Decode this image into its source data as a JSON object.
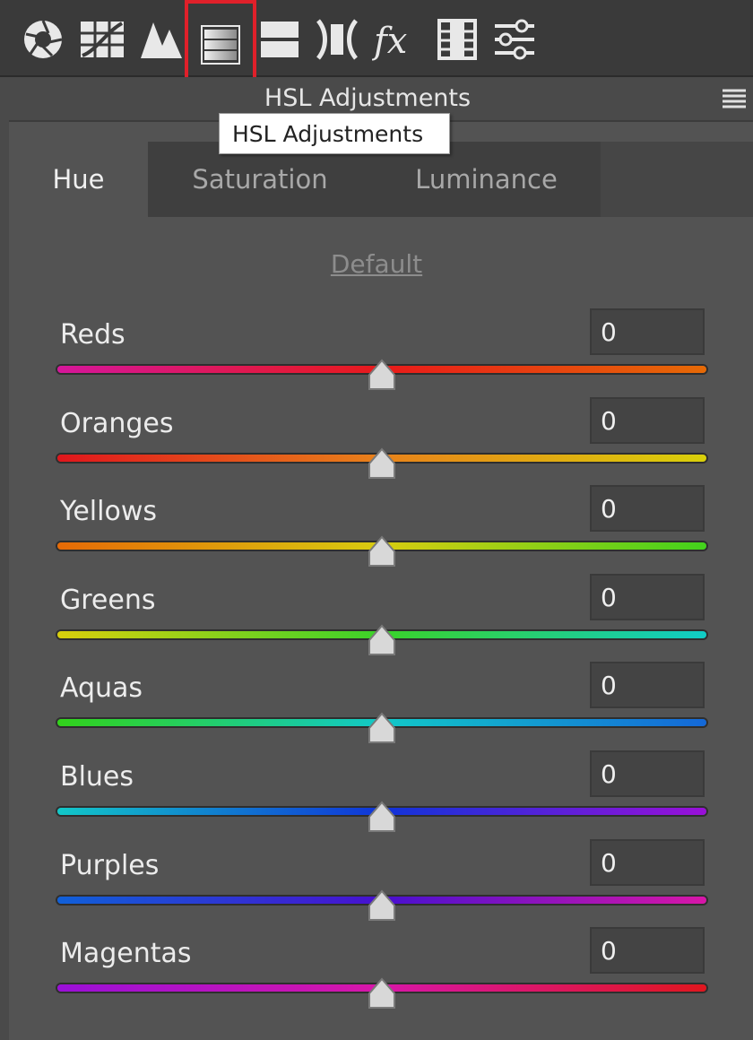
{
  "toolbar": {
    "icons": [
      {
        "name": "basic-aperture-icon"
      },
      {
        "name": "tone-curve-icon"
      },
      {
        "name": "detail-mountain-icon"
      },
      {
        "name": "hsl-adjustments-icon",
        "selected": true
      },
      {
        "name": "split-toning-icon"
      },
      {
        "name": "lens-corrections-icon"
      },
      {
        "name": "fx-effects-icon"
      },
      {
        "name": "camera-calibration-film-icon"
      },
      {
        "name": "presets-sliders-icon"
      }
    ]
  },
  "panel": {
    "title": "HSL Adjustments",
    "tooltip": "HSL Adjustments",
    "menu_icon": "panel-menu-icon"
  },
  "tabs": [
    {
      "label": "Hue",
      "active": true
    },
    {
      "label": "Saturation",
      "active": false
    },
    {
      "label": "Luminance",
      "active": false
    }
  ],
  "default_label": "Default",
  "sliders": [
    {
      "label": "Reds",
      "value": "0",
      "min": -100,
      "max": 100,
      "gradient": [
        "#d5169b",
        "#e81a1a",
        "#e66a06"
      ]
    },
    {
      "label": "Oranges",
      "value": "0",
      "min": -100,
      "max": 100,
      "gradient": [
        "#e0161c",
        "#e8821a",
        "#d9d00a"
      ]
    },
    {
      "label": "Yellows",
      "value": "0",
      "min": -100,
      "max": 100,
      "gradient": [
        "#e66a06",
        "#d8cc10",
        "#42d21c"
      ]
    },
    {
      "label": "Greens",
      "value": "0",
      "min": -100,
      "max": 100,
      "gradient": [
        "#d9cf0c",
        "#3ad22a",
        "#10ccc6"
      ]
    },
    {
      "label": "Aquas",
      "value": "0",
      "min": -100,
      "max": 100,
      "gradient": [
        "#32d21a",
        "#12c8c8",
        "#1468d8"
      ]
    },
    {
      "label": "Blues",
      "value": "0",
      "min": -100,
      "max": 100,
      "gradient": [
        "#12c8c8",
        "#1034d8",
        "#9a10d8"
      ]
    },
    {
      "label": "Purples",
      "value": "0",
      "min": -100,
      "max": 100,
      "gradient": [
        "#1060d8",
        "#4810d0",
        "#d816a8"
      ]
    },
    {
      "label": "Magentas",
      "value": "0",
      "min": -100,
      "max": 100,
      "gradient": [
        "#9a10d8",
        "#d816a8",
        "#e0161e"
      ]
    }
  ]
}
